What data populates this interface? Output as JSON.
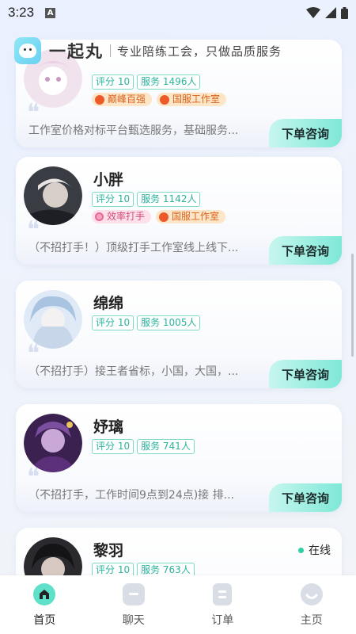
{
  "status_bar": {
    "time": "3:23",
    "notif_letter": "A"
  },
  "header": {
    "app_title": "一起丸",
    "slogan": "专业陪练工会，只做品质服务"
  },
  "cards": [
    {
      "name": "",
      "rating": "评分 10",
      "service": "服务 1496人",
      "badges": [
        {
          "label": "巅峰百强",
          "style": "orange"
        },
        {
          "label": "国服工作室",
          "style": "orange"
        }
      ],
      "desc": "工作室价格对标平台甄选服务，基础服务...",
      "button": "下单咨询",
      "online": ""
    },
    {
      "name": "小胖",
      "rating": "评分 10",
      "service": "服务 1142人",
      "badges": [
        {
          "label": "效率打手",
          "style": "pink"
        },
        {
          "label": "国服工作室",
          "style": "orange"
        }
      ],
      "desc": "（不招打手！）顶级打手工作室线上线下...",
      "button": "下单咨询",
      "online": ""
    },
    {
      "name": "绵绵",
      "rating": "评分 10",
      "service": "服务 1005人",
      "badges": [],
      "desc": "（不招打手）接王者省标，小国，大国，...",
      "button": "下单咨询",
      "online": ""
    },
    {
      "name": "妤璃",
      "rating": "评分 10",
      "service": "服务 741人",
      "badges": [],
      "desc": "（不招打手，工作时间9点到24点)接 排...",
      "button": "下单咨询",
      "online": ""
    },
    {
      "name": "黎羽",
      "rating": "评分 10",
      "service": "服务 763人",
      "badges": [],
      "desc": "",
      "button": "",
      "online": "在线"
    }
  ],
  "nav": [
    {
      "label": "首页",
      "icon": "home-icon",
      "active": true
    },
    {
      "label": "聊天",
      "icon": "chat-icon",
      "active": false
    },
    {
      "label": "订单",
      "icon": "order-icon",
      "active": false
    },
    {
      "label": "主页",
      "icon": "profile-icon",
      "active": false
    }
  ],
  "colors": {
    "accent": "#5fe0c9",
    "tag_text": "#2bb39d",
    "badge_orange": "#d9621e",
    "badge_pink": "#d24c7a",
    "online_dot": "#2fd0a6"
  }
}
